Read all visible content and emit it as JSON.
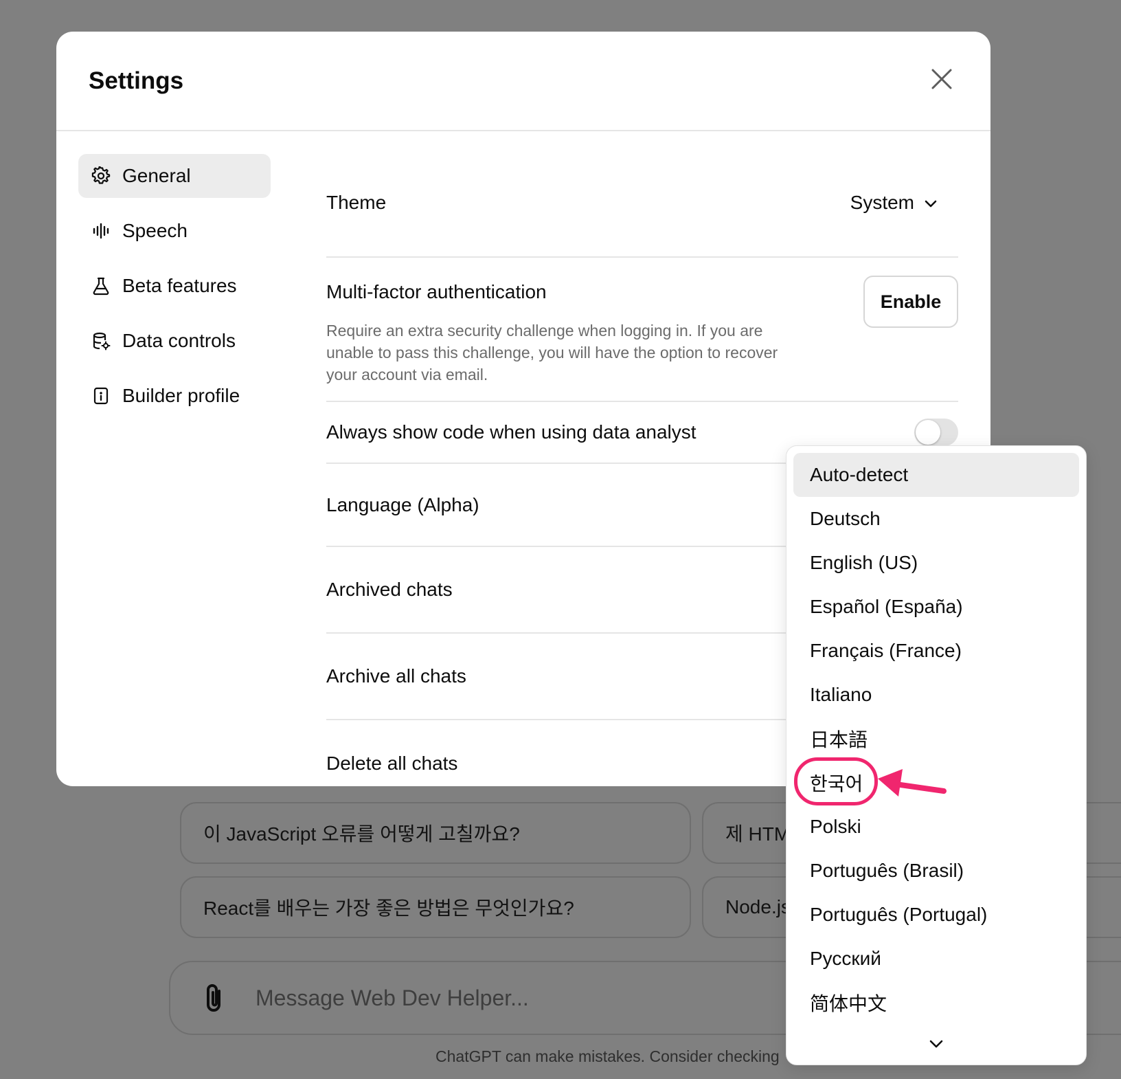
{
  "background": {
    "suggestions": [
      "이 JavaScript 오류를 어떻게 고칠까요?",
      "제 HTM",
      "React를 배우는 가장 좋은 방법은 무엇인가요?",
      "Node.js"
    ],
    "composer": {
      "placeholder": "Message Web Dev Helper...",
      "attach_icon": "paperclip-icon"
    },
    "disclaimer": "ChatGPT can make mistakes. Consider checking"
  },
  "modal": {
    "title": "Settings",
    "close_icon": "close-icon",
    "sidebar": {
      "items": [
        {
          "label": "General",
          "icon": "gear-icon",
          "active": true
        },
        {
          "label": "Speech",
          "icon": "waveform-icon",
          "active": false
        },
        {
          "label": "Beta features",
          "icon": "flask-icon",
          "active": false
        },
        {
          "label": "Data controls",
          "icon": "database-gear-icon",
          "active": false
        },
        {
          "label": "Builder profile",
          "icon": "id-badge-icon",
          "active": false
        }
      ]
    },
    "general": {
      "theme": {
        "label": "Theme",
        "value": "System"
      },
      "mfa": {
        "label": "Multi-factor authentication",
        "description": "Require an extra security challenge when logging in. If you are unable to pass this challenge, you will have the option to recover your account via email.",
        "button": "Enable"
      },
      "code_toggle": {
        "label": "Always show code when using data analyst",
        "enabled": false
      },
      "language": {
        "label": "Language (Alpha)"
      },
      "archived_chats": {
        "label": "Archived chats"
      },
      "archive_all": {
        "label": "Archive all chats"
      },
      "delete_all": {
        "label": "Delete all chats"
      }
    }
  },
  "language_dropdown": {
    "selected": "Auto-detect",
    "highlighted": "한국어",
    "options": [
      "Auto-detect",
      "Deutsch",
      "English (US)",
      "Español (España)",
      "Français (France)",
      "Italiano",
      "日本語",
      "한국어",
      "Polski",
      "Português (Brasil)",
      "Português (Portugal)",
      "Русский",
      "简体中文"
    ],
    "more_icon": "chevron-down-icon"
  },
  "colors": {
    "overlay": "#808080",
    "annotation": "#f0266e",
    "active_bg": "#ececec"
  }
}
